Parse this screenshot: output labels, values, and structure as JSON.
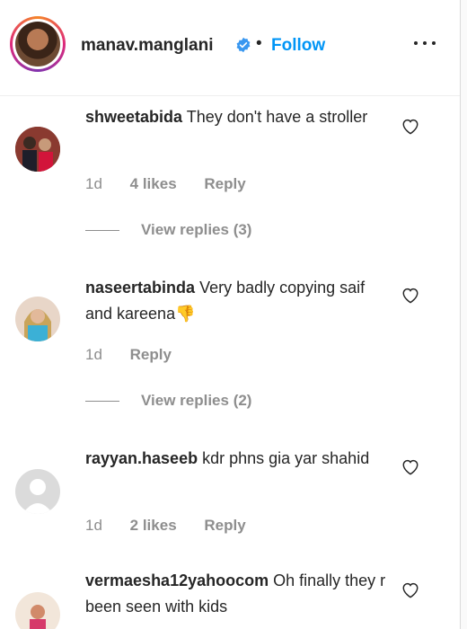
{
  "header": {
    "username": "manav.manglani",
    "separator": "•",
    "follow_label": "Follow"
  },
  "comments": [
    {
      "username": "shweetabida",
      "text": "They don't have a stroller",
      "time": "1d",
      "likes": "4 likes",
      "reply_label": "Reply",
      "view_replies": "View replies (3)"
    },
    {
      "username": "naseertabinda",
      "text": "Very badly copying saif and kareena",
      "emoji": "👎",
      "time": "1d",
      "reply_label": "Reply",
      "view_replies": "View replies (2)"
    },
    {
      "username": "rayyan.haseeb",
      "text": "kdr phns gia yar shahid",
      "time": "1d",
      "likes": "2 likes",
      "reply_label": "Reply"
    },
    {
      "username": "vermaesha12yahoocom",
      "text": "Oh finally they r been seen with kids"
    }
  ],
  "colors": {
    "follow": "#0095f6",
    "verified": "#3897f0",
    "muted": "#8e8e8e"
  }
}
